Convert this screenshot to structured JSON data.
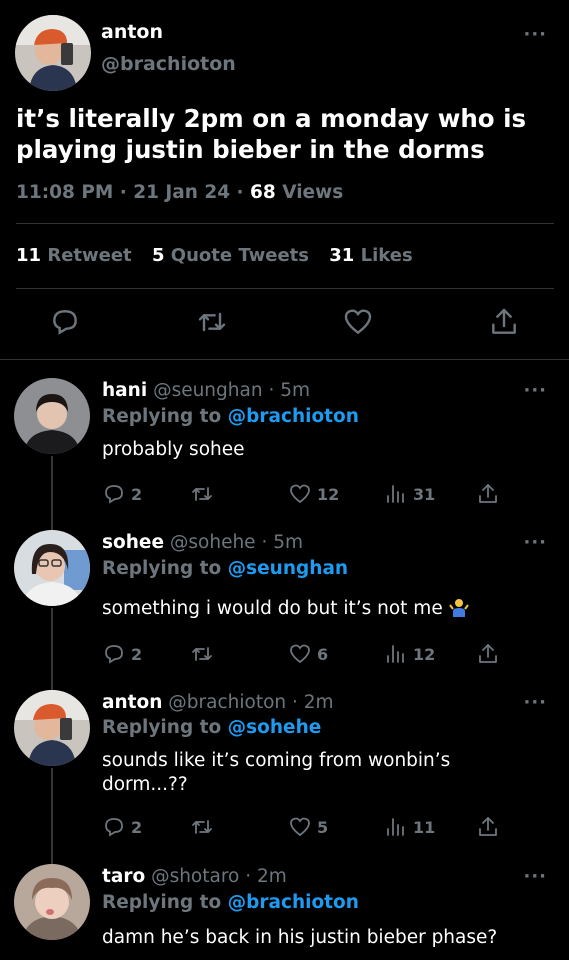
{
  "main_tweet": {
    "name": "anton",
    "handle": "@brachioton",
    "more": "···",
    "text": "it’s literally 2pm on a monday who is playing justin bieber in the dorms",
    "time": "11:08 PM · 21 Jan 24 · ",
    "views_count": "68",
    "views_label": " Views",
    "stats": {
      "retweets": "11",
      "retweets_label": "Retweet",
      "quotes": "5",
      "quotes_label": "Quote Tweets",
      "likes": "31",
      "likes_label": "Likes"
    },
    "icons": [
      "reply-icon",
      "retweet-icon",
      "like-icon",
      "share-icon"
    ]
  },
  "replies": [
    {
      "name": "hani",
      "handle": "@seunghan",
      "time": "5m",
      "replying_label": "Replying to ",
      "replying_to": "@brachioton",
      "text": "probably sohee",
      "replies": "2",
      "likes": "12",
      "views": "31"
    },
    {
      "name": "sohee",
      "handle": "@sohehe",
      "time": "5m",
      "replying_label": "Replying to ",
      "replying_to": "@seunghan",
      "text": "something i would do but it’s not me",
      "emoji": "person-shrugging-emoji",
      "replies": "2",
      "likes": "6",
      "views": "12"
    },
    {
      "name": "anton",
      "handle": "@brachioton",
      "time": "2m",
      "replying_label": "Replying to ",
      "replying_to": "@sohehe",
      "text": "sounds like it’s coming from wonbin’s dorm...??",
      "replies": "2",
      "likes": "5",
      "views": "11"
    },
    {
      "name": "taro",
      "handle": "@shotaro",
      "time": "2m",
      "replying_label": "Replying to ",
      "replying_to": "@brachioton",
      "text": "damn he’s back in his justin bieber phase?"
    }
  ],
  "colors": {
    "background": "#000000",
    "accent": "#1d9bf0",
    "muted": "#6e767d",
    "divider": "#2f3336"
  }
}
